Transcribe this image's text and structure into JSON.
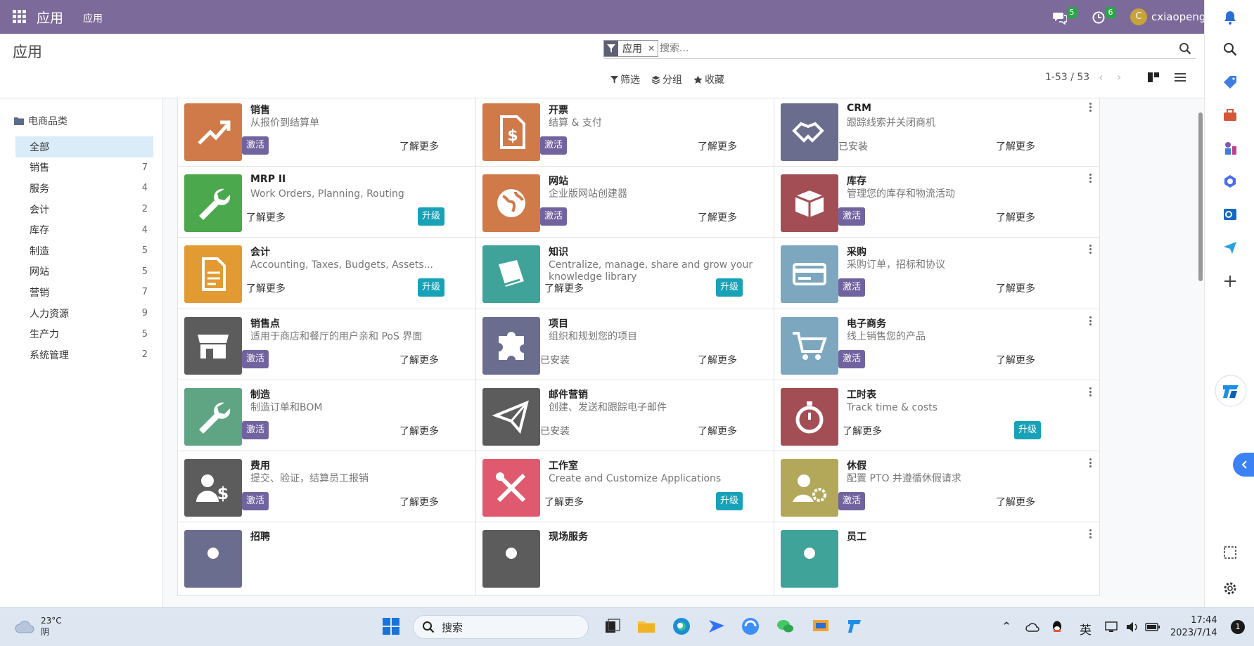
{
  "topbar": {
    "brand": "应用",
    "menu": "应用",
    "messages_count": "5",
    "activities_count": "6",
    "avatar_letter": "C",
    "username": "cxiaopeng",
    "color": "#7c6a9b"
  },
  "control": {
    "title": "应用",
    "facet": "应用",
    "search_placeholder": "搜索...",
    "filter": "筛选",
    "groupby": "分组",
    "favorites": "收藏",
    "pager": "1-53 / 53"
  },
  "sidebar": {
    "header": "电商品类",
    "items": [
      {
        "label": "全部",
        "count": ""
      },
      {
        "label": "销售",
        "count": "7"
      },
      {
        "label": "服务",
        "count": "4"
      },
      {
        "label": "会计",
        "count": "2"
      },
      {
        "label": "库存",
        "count": "4"
      },
      {
        "label": "制造",
        "count": "5"
      },
      {
        "label": "网站",
        "count": "5"
      },
      {
        "label": "营销",
        "count": "7"
      },
      {
        "label": "人力资源",
        "count": "9"
      },
      {
        "label": "生产力",
        "count": "5"
      },
      {
        "label": "系统管理",
        "count": "2"
      }
    ]
  },
  "labels": {
    "activate": "激活",
    "upgrade": "升级",
    "installed": "已安装",
    "learn_more": "了解更多"
  },
  "apps": [
    {
      "name": "销售",
      "desc": "从报价到结算单",
      "status": "activate",
      "color": "#d07a4a",
      "icon": "chart-up-icon"
    },
    {
      "name": "开票",
      "desc": "结算 & 支付",
      "status": "activate",
      "color": "#d07a4a",
      "icon": "invoice-icon"
    },
    {
      "name": "CRM",
      "desc": "跟踪线索并关闭商机",
      "status": "installed",
      "color": "#6b6d8f",
      "icon": "handshake-icon"
    },
    {
      "name": "MRP II",
      "desc": "Work Orders, Planning, Routing",
      "status": "upgrade",
      "color": "#4ba84d",
      "icon": "wrench-icon"
    },
    {
      "name": "网站",
      "desc": "企业版网站创建器",
      "status": "activate",
      "color": "#d07a4a",
      "icon": "globe-icon"
    },
    {
      "name": "库存",
      "desc": "管理您的库存和物流活动",
      "status": "activate",
      "color": "#a34d55",
      "icon": "box-icon"
    },
    {
      "name": "会计",
      "desc": "Accounting, Taxes, Budgets, Assets...",
      "status": "upgrade",
      "color": "#e29a33",
      "icon": "document-icon"
    },
    {
      "name": "知识",
      "desc": "Centralize, manage, share and grow your knowledge library",
      "status": "upgrade",
      "color": "#3fa39a",
      "icon": "book-icon"
    },
    {
      "name": "采购",
      "desc": "采购订单，招标和协议",
      "status": "activate",
      "color": "#7ca7bf",
      "icon": "card-icon"
    },
    {
      "name": "销售点",
      "desc": "适用于商店和餐厅的用户亲和 PoS 界面",
      "status": "activate",
      "color": "#5c5c5c",
      "icon": "store-icon"
    },
    {
      "name": "项目",
      "desc": "组织和规划您的项目",
      "status": "installed",
      "color": "#6b6d8f",
      "icon": "puzzle-icon"
    },
    {
      "name": "电子商务",
      "desc": "线上销售您的产品",
      "status": "activate",
      "color": "#7ca7bf",
      "icon": "cart-icon"
    },
    {
      "name": "制造",
      "desc": "制造订单和BOM",
      "status": "activate",
      "color": "#5fa584",
      "icon": "wrench-icon"
    },
    {
      "name": "邮件营销",
      "desc": "创建、发送和跟踪电子邮件",
      "status": "installed",
      "color": "#5c5c5c",
      "icon": "paper-plane-icon"
    },
    {
      "name": "工时表",
      "desc": "Track time & costs",
      "status": "upgrade",
      "color": "#a34d55",
      "icon": "stopwatch-icon"
    },
    {
      "name": "费用",
      "desc": "提交、验证，结算员工报销",
      "status": "activate",
      "color": "#5c5c5c",
      "icon": "user-dollar-icon"
    },
    {
      "name": "工作室",
      "desc": "Create and Customize Applications",
      "status": "upgrade",
      "color": "#e05a6f",
      "icon": "tools-icon"
    },
    {
      "name": "休假",
      "desc": "配置 PTO 并遵循休假请求",
      "status": "activate",
      "color": "#b3a85a",
      "icon": "user-gear-icon"
    },
    {
      "name": "招聘",
      "desc": "",
      "status": "",
      "color": "#6b6d8f",
      "icon": "recruit-icon"
    },
    {
      "name": "现场服务",
      "desc": "",
      "status": "",
      "color": "#5c5c5c",
      "icon": "field-service-icon"
    },
    {
      "name": "员工",
      "desc": "",
      "status": "",
      "color": "#3fa39a",
      "icon": "employees-icon"
    }
  ],
  "taskbar": {
    "temp": "23°C",
    "weather": "阴",
    "search": "搜索",
    "ime": "英",
    "time": "17:44",
    "date": "2023/7/14",
    "notif": "1"
  }
}
